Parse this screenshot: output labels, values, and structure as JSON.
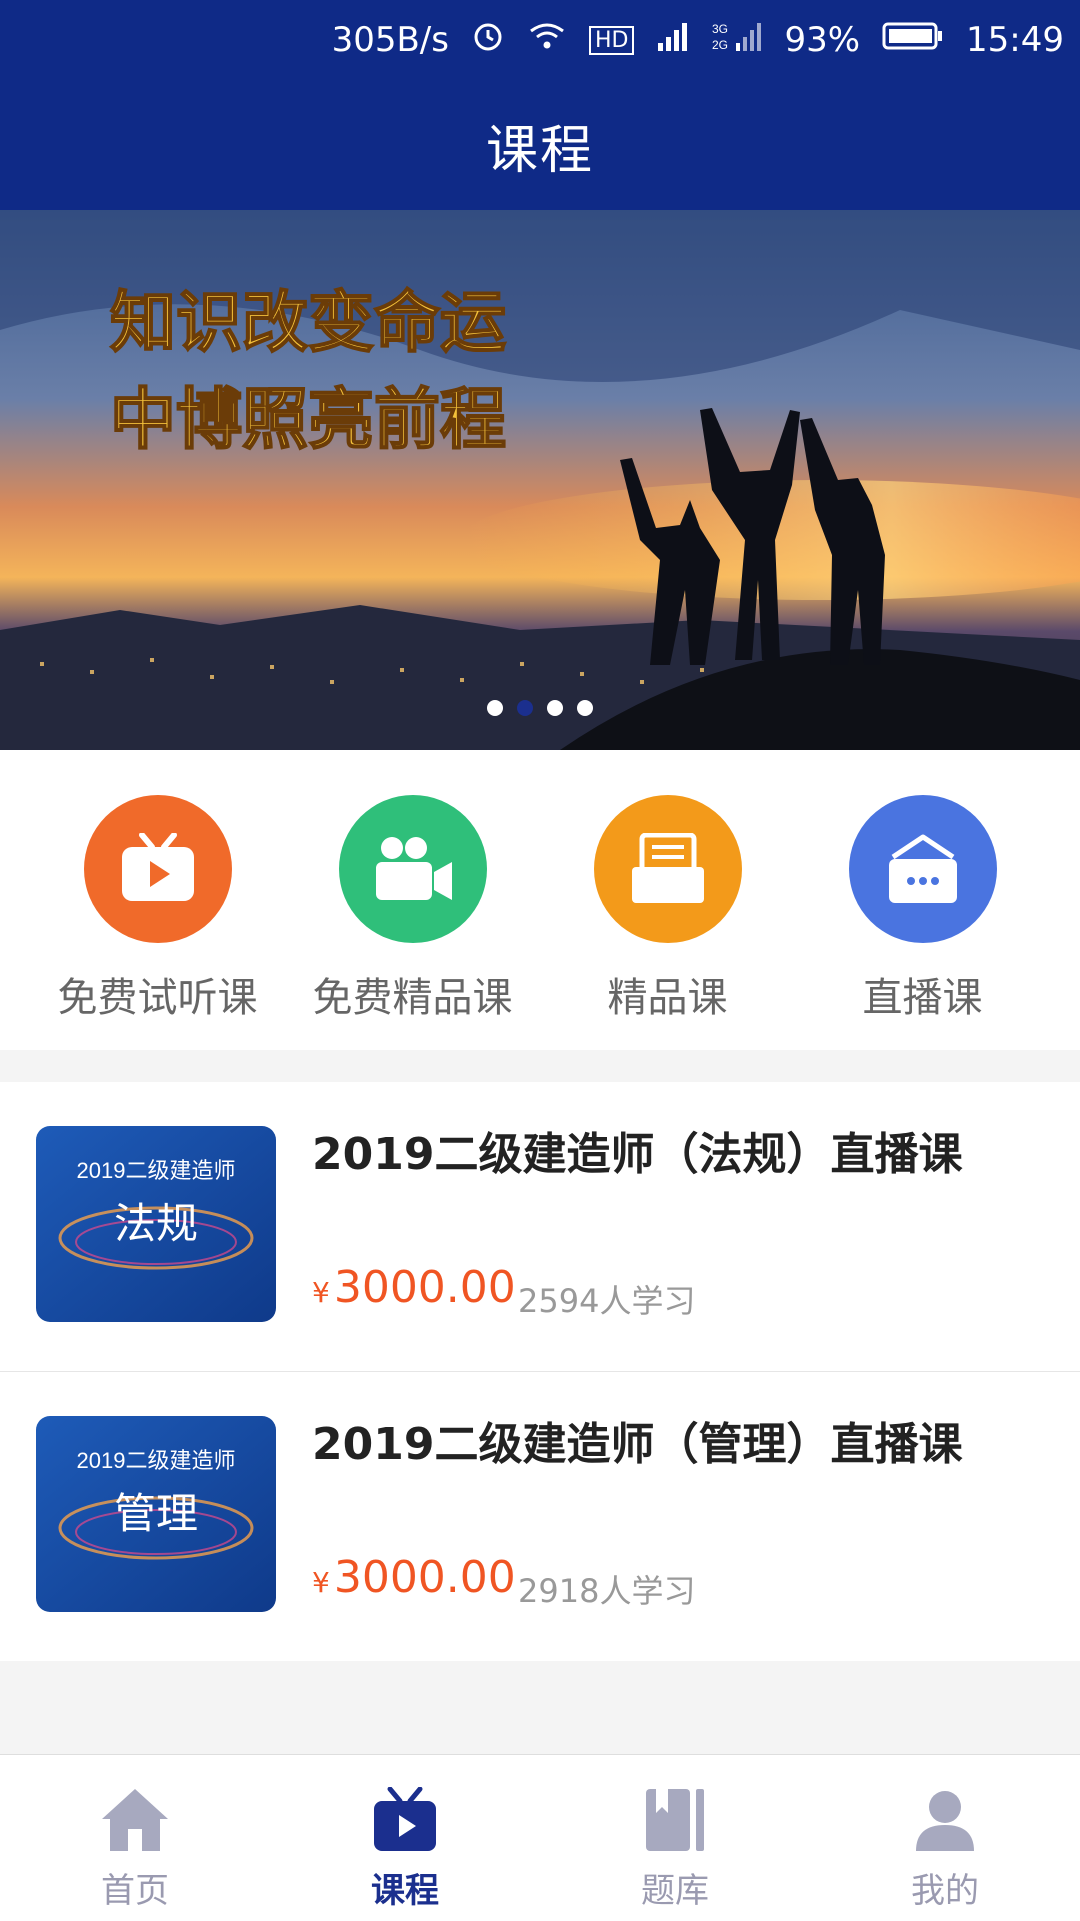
{
  "status_bar": {
    "net_speed": "305B/s",
    "hd": "HD",
    "battery": "93%",
    "time": "15:49"
  },
  "app_bar": {
    "title": "课程"
  },
  "banner": {
    "line1": "知识改变命运",
    "line2": "中博照亮前程",
    "dots_total": 4,
    "dots_active_index": 1
  },
  "categories": [
    {
      "label": "免费试听课",
      "icon": "tv-play-icon",
      "color": "#f06a2a"
    },
    {
      "label": "免费精品课",
      "icon": "video-camera-icon",
      "color": "#2fbf7a"
    },
    {
      "label": "精品课",
      "icon": "document-icon",
      "color": "#f39a1a"
    },
    {
      "label": "直播课",
      "icon": "live-sign-icon",
      "color": "#4a74e0"
    }
  ],
  "courses": [
    {
      "title": "2019二级建造师（法规）直播课",
      "thumb_top": "2019二级建造师",
      "thumb_main": "法规",
      "currency": "¥",
      "price": "3000.00",
      "learners": "2594人学习"
    },
    {
      "title": "2019二级建造师（管理）直播课",
      "thumb_top": "2019二级建造师",
      "thumb_main": "管理",
      "currency": "¥",
      "price": "3000.00",
      "learners": "2918人学习"
    }
  ],
  "tabs": [
    {
      "label": "首页",
      "icon": "home-icon"
    },
    {
      "label": "课程",
      "icon": "tv-icon",
      "active": true
    },
    {
      "label": "题库",
      "icon": "book-icon"
    },
    {
      "label": "我的",
      "icon": "person-icon"
    }
  ],
  "colors": {
    "primary": "#0f2a87",
    "price": "#f05523",
    "tab_inactive": "#9a9ab0",
    "tab_active": "#1b2f8e"
  }
}
